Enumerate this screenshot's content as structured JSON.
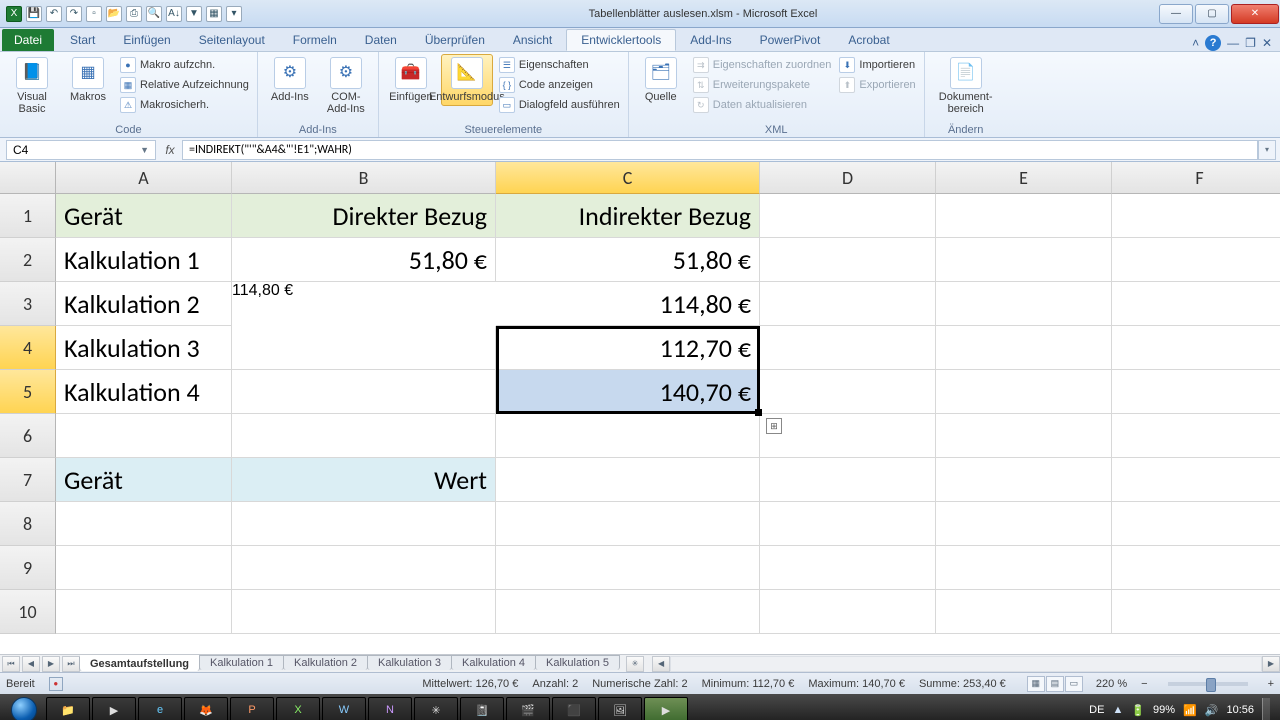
{
  "app": {
    "title": "Tabellenblätter auslesen.xlsm  -  Microsoft Excel"
  },
  "qat_icons": [
    "save-icon",
    "undo-icon",
    "redo-icon",
    "new-icon",
    "open-icon",
    "print-icon",
    "preview-icon",
    "sort-icon",
    "filter-icon",
    "table-icon",
    "close-icon"
  ],
  "ribbon_tabs": {
    "file": "Datei",
    "items": [
      "Start",
      "Einfügen",
      "Seitenlayout",
      "Formeln",
      "Daten",
      "Überprüfen",
      "Ansicht",
      "Entwicklertools",
      "Add-Ins",
      "PowerPivot",
      "Acrobat"
    ],
    "active": "Entwicklertools"
  },
  "ribbon": {
    "code": {
      "visual_basic": "Visual Basic",
      "makros": "Makros",
      "aufz": "Makro aufzchn.",
      "relativ": "Relative Aufzeichnung",
      "sicher": "Makrosicherh.",
      "label": "Code"
    },
    "addins": {
      "addins": "Add-Ins",
      "com": "COM-Add-Ins",
      "label": "Add-Ins"
    },
    "controls": {
      "einfuegen": "Einfügen",
      "entwurf": "Entwurfsmodus",
      "eigensch": "Eigenschaften",
      "code_anz": "Code anzeigen",
      "dialog": "Dialogfeld ausführen",
      "label": "Steuerelemente"
    },
    "xml": {
      "quelle": "Quelle",
      "eig_zu": "Eigenschaften zuordnen",
      "erw": "Erweiterungspakete",
      "aktual": "Daten aktualisieren",
      "import": "Importieren",
      "export": "Exportieren",
      "label": "XML"
    },
    "aendern": {
      "dok": "Dokument-bereich",
      "label": "Ändern"
    }
  },
  "namebox": "C4",
  "formula": "=INDIREKT(\"'\"&A4&\"'!E1\";WAHR)",
  "columns": [
    "A",
    "B",
    "C",
    "D",
    "E",
    "F"
  ],
  "rows": [
    "1",
    "2",
    "3",
    "4",
    "5",
    "6",
    "7",
    "8",
    "9",
    "10"
  ],
  "cells": {
    "A1": "Gerät",
    "B1": "Direkter Bezug",
    "C1": "Indirekter Bezug",
    "A2": "Kalkulation 1",
    "B2": "51,80 €",
    "C2": "51,80 €",
    "A3": "Kalkulation 2",
    "B3": "114,80 €",
    "C3": "114,80 €",
    "A4": "Kalkulation 3",
    "C4": "112,70 €",
    "A5": "Kalkulation 4",
    "C5": "140,70 €",
    "A7": "Gerät",
    "B7": "Wert"
  },
  "sheets": {
    "active": "Gesamtaufstellung",
    "tabs": [
      "Gesamtaufstellung",
      "Kalkulation 1",
      "Kalkulation 2",
      "Kalkulation 3",
      "Kalkulation 4",
      "Kalkulation 5"
    ]
  },
  "status": {
    "ready": "Bereit",
    "mittelwert": "Mittelwert: 126,70 €",
    "anzahl": "Anzahl: 2",
    "numerisch": "Numerische Zahl: 2",
    "minimum": "Minimum: 112,70 €",
    "maximum": "Maximum: 140,70 €",
    "summe": "Summe: 253,40 €",
    "zoom": "220 %"
  },
  "system": {
    "lang": "DE",
    "battery": "99%",
    "clock": "10:56"
  }
}
